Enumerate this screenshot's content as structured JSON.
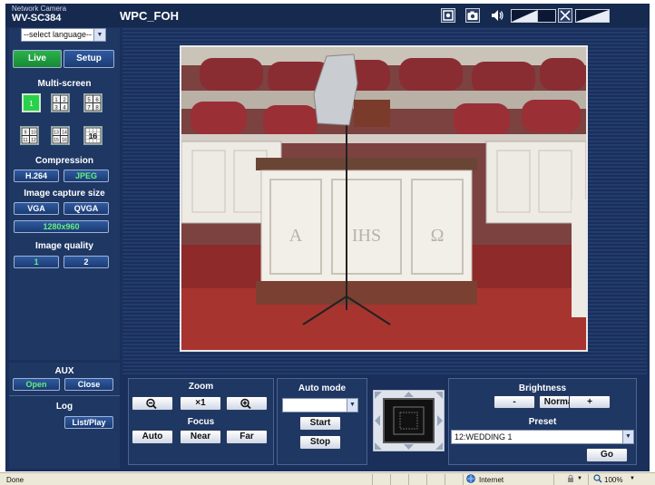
{
  "header": {
    "brand_small": "Network Camera",
    "model": "WV-SC384",
    "camera_title": "WPC_FOH",
    "icons": [
      "snapshot-icon",
      "camera-icon",
      "speaker-icon",
      "volume-bar",
      "mic-mute-icon",
      "volume-bar"
    ]
  },
  "sidebar": {
    "language_select": "--select language--",
    "live_label": "Live",
    "setup_label": "Setup",
    "multiscreen_label": "Multi-screen",
    "multiscreen_options": [
      "1",
      "1 2 3 4",
      "5 6 7 8",
      "9 10 11 12",
      "13 14 15 16",
      "16"
    ],
    "compression_label": "Compression",
    "h264_label": "H.264",
    "jpeg_label": "JPEG",
    "capture_size_label": "Image capture size",
    "vga_label": "VGA",
    "qvga_label": "QVGA",
    "size_1280_label": "1280x960",
    "quality_label": "Image quality",
    "quality_1": "1",
    "quality_2": "2",
    "aux_label": "AUX",
    "aux_open": "Open",
    "aux_close": "Close",
    "log_label": "Log",
    "log_button": "List/Play"
  },
  "controls": {
    "zoom_label": "Zoom",
    "zoom_x1": "×1",
    "focus_label": "Focus",
    "focus_auto": "Auto",
    "focus_near": "Near",
    "focus_far": "Far",
    "automode_label": "Auto mode",
    "automode_value": "",
    "start_label": "Start",
    "stop_label": "Stop",
    "brightness_label": "Brightness",
    "brightness_minus": "-",
    "brightness_normal": "Normal",
    "brightness_plus": "+",
    "preset_label": "Preset",
    "preset_value": "12:WEDDING 1",
    "go_label": "Go"
  },
  "video_scene": {
    "letters": [
      "A",
      "IHS",
      "Ω"
    ]
  },
  "statusbar": {
    "status": "Done",
    "zone": "Internet",
    "zoom": "100%"
  },
  "colors": {
    "frame": "#1a2f5a",
    "panel": "#1f3763",
    "accent_green": "#62ef7e",
    "live_green": "#2bb24a"
  }
}
